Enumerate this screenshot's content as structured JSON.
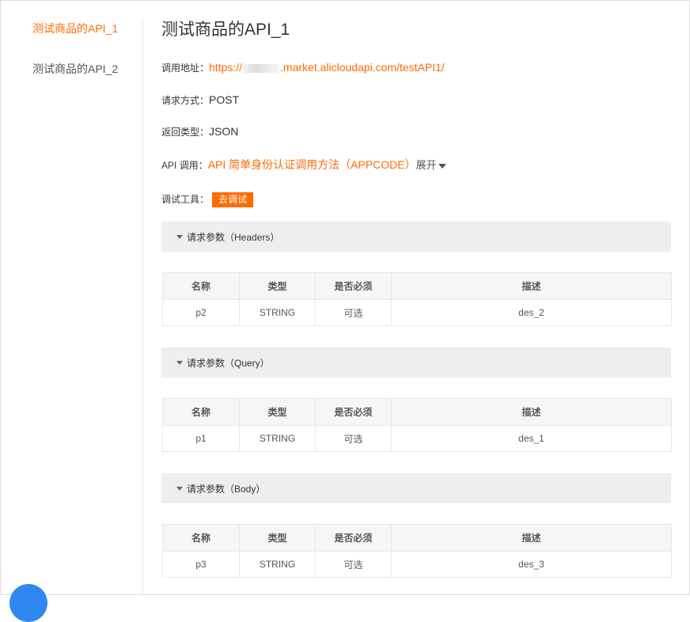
{
  "sidebar": {
    "items": [
      {
        "label": "测试商品的API_1",
        "active": true
      },
      {
        "label": "测试商品的API_2",
        "active": false
      }
    ]
  },
  "api": {
    "title": "测试商品的API_1",
    "url_label": "调用地址：",
    "url_prefix": "https://",
    "url_suffix": ".market.alicloudapi.com/testAPI1/",
    "method_label": "请求方式：",
    "method": "POST",
    "return_label": "返回类型：",
    "return_type": "JSON",
    "call_label": "API 调用：",
    "call_link": "API 简单身份认证调用方法（APPCODE）",
    "expand_label": "展开",
    "tool_label": "调试工具：",
    "debug_button": "去调试"
  },
  "table_headers": [
    "名称",
    "类型",
    "是否必须",
    "描述"
  ],
  "sections": [
    {
      "title": "请求参数（Headers）",
      "rows": [
        {
          "name": "p2",
          "type": "STRING",
          "required": "可选",
          "desc": "des_2"
        }
      ]
    },
    {
      "title": "请求参数（Query）",
      "rows": [
        {
          "name": "p1",
          "type": "STRING",
          "required": "可选",
          "desc": "des_1"
        }
      ]
    },
    {
      "title": "请求参数（Body）",
      "rows": [
        {
          "name": "p3",
          "type": "STRING",
          "required": "可选",
          "desc": "des_3"
        }
      ]
    }
  ],
  "colors": {
    "accent": "#ff6a00",
    "fab": "#2f87f0"
  }
}
